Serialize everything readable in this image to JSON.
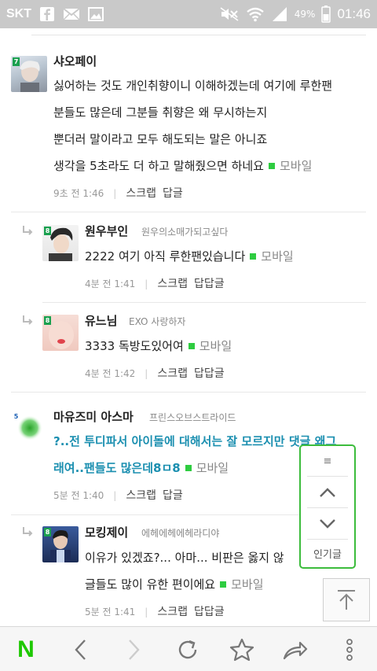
{
  "status_bar": {
    "carrier": "SKT",
    "battery": "49%",
    "time": "01:46",
    "icons": [
      "facebook-icon",
      "mail-icon",
      "image-icon",
      "mute-icon",
      "wifi-icon",
      "signal-icon",
      "battery-icon"
    ]
  },
  "comments": [
    {
      "nick": "샤오페이",
      "subnick": "",
      "level": "7",
      "lines": [
        "싫어하는 것도 개인취향이니 이해하겠는데 여기에 루한팬",
        "분들도 많은데 그분들 취향은 왜 무시하는지",
        "뿐더러 말이라고 모두 해도되는 말은 아니죠",
        "생각을 5초라도 더 하고 말해줬으면 하네요"
      ],
      "mobile": "모바일",
      "time": "9초 전 1:46",
      "action1": "스크랩",
      "action2": "답글"
    },
    {
      "nick": "원우부인",
      "subnick": "원우의소매가되고싶다",
      "level": "8",
      "lines": [
        "2222 여기 아직 루한팬있습니다"
      ],
      "mobile": "모바일",
      "time": "4분 전 1:41",
      "action1": "스크랩",
      "action2": "답답글"
    },
    {
      "nick": "유느님",
      "subnick": "EXO 사랑하자",
      "level": "8",
      "lines": [
        "3333 독방도있어여"
      ],
      "mobile": "모바일",
      "time": "4분 전 1:42",
      "action1": "스크랩",
      "action2": "답답글"
    },
    {
      "nick": "마유즈미 아스마",
      "subnick": "프린스오브스트라이드",
      "level": "5",
      "lines": [
        "?..전 투디파서 아이돌에 대해서는 잘 모르지만 댓글 왜그",
        "래여..팬들도 많은데8ㅁ8"
      ],
      "mobile": "모바일",
      "time": "5분 전 1:40",
      "action1": "스크랩",
      "action2": "답글"
    },
    {
      "nick": "모킹제이",
      "subnick": "에헤에헤에헤라디야",
      "level": "8",
      "lines": [
        "이유가 있겠죠?... 아마... 비판은 옳지 않",
        "글들도 많이 유한 편이에요"
      ],
      "mobile": "모바일",
      "time": "5분 전 1:41",
      "action1": "스크랩",
      "action2": "답답글"
    }
  ],
  "float_nav": {
    "menu_icon": "≡",
    "popular_label": "인기글"
  },
  "bottom_bar": {
    "logo": "N"
  }
}
